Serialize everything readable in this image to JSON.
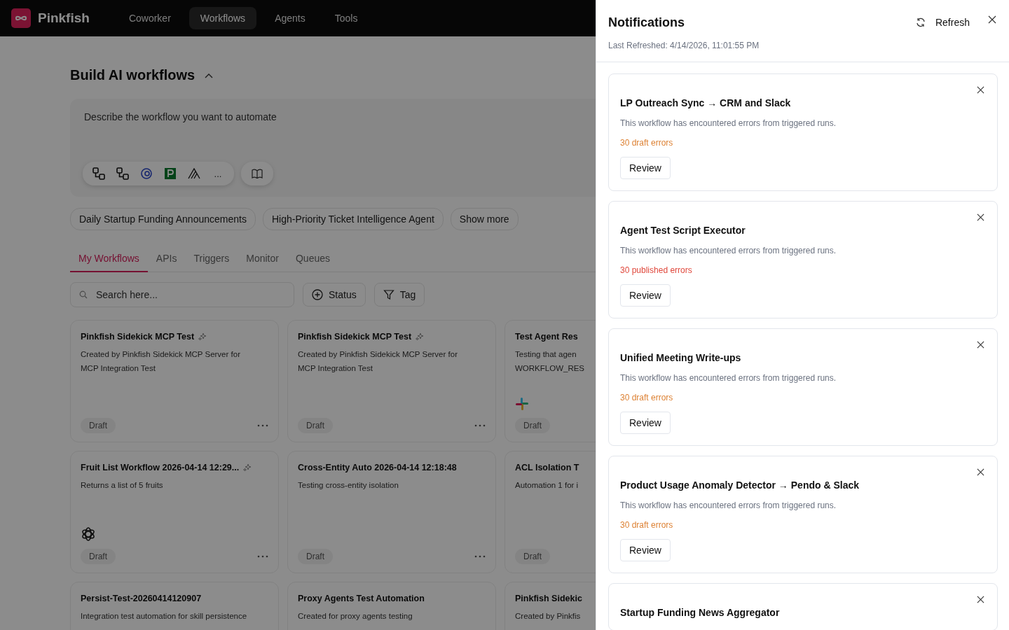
{
  "app": {
    "brand": "Pinkfish"
  },
  "nav": [
    {
      "label": "Coworker",
      "selected": false
    },
    {
      "label": "Workflows",
      "selected": true
    },
    {
      "label": "Agents",
      "selected": false
    },
    {
      "label": "Tools",
      "selected": false
    }
  ],
  "builder": {
    "title": "Build AI workflows",
    "placeholder": "Describe the workflow you want to automate",
    "more": "..."
  },
  "suggestions": [
    "Daily Startup Funding Announcements",
    "High-Priority Ticket Intelligence Agent",
    "Show more"
  ],
  "tabs": [
    {
      "label": "My Workflows",
      "selected": true
    },
    {
      "label": "APIs",
      "selected": false
    },
    {
      "label": "Triggers",
      "selected": false
    },
    {
      "label": "Monitor",
      "selected": false
    },
    {
      "label": "Queues",
      "selected": false
    }
  ],
  "search": {
    "placeholder": "Search here..."
  },
  "filters": [
    {
      "label": "Status",
      "kind": "add"
    },
    {
      "label": "Tag",
      "kind": "filter"
    }
  ],
  "workflows": [
    {
      "title": "Pinkfish Sidekick MCP Test",
      "ai": true,
      "description": [
        "Created by Pinkfish Sidekick MCP Server for",
        "MCP Integration Test"
      ],
      "kind": "plain",
      "status": "Draft"
    },
    {
      "title": "Pinkfish Sidekick MCP Test",
      "ai": true,
      "description": [
        "Created by Pinkfish Sidekick MCP Server for",
        "MCP Integration Test"
      ],
      "kind": "plain",
      "status": "Draft"
    },
    {
      "title": "Test Agent Res",
      "ai": false,
      "description": [
        "Testing that agen",
        "WORKFLOW_RES"
      ],
      "kind": "slack",
      "status": "Draft"
    },
    {
      "title": "Fruit List Workflow 2026-04-14 12:29...",
      "ai": true,
      "description": [
        "Returns a list of 5 fruits"
      ],
      "kind": "openai",
      "status": "Draft"
    },
    {
      "title": "Cross-Entity Auto 2026-04-14 12:18:48",
      "ai": false,
      "description": [
        "Testing cross-entity isolation"
      ],
      "kind": "plain",
      "status": "Draft"
    },
    {
      "title": "ACL Isolation T",
      "ai": false,
      "description": [
        "Automation 1 for i"
      ],
      "kind": "plain",
      "status": "Draft"
    },
    {
      "title": "Persist-Test-20260414120907",
      "ai": false,
      "description": [
        "Integration test automation for skill persistence"
      ],
      "kind": "plain"
    },
    {
      "title": "Proxy Agents Test Automation",
      "ai": false,
      "description": [
        "Created for proxy agents testing"
      ],
      "kind": "plain"
    },
    {
      "title": "Pinkfish Sidekic",
      "ai": false,
      "description": [
        "Created by Pinkfis"
      ],
      "kind": "plain"
    }
  ],
  "notifications": {
    "title": "Notifications",
    "refresh": "Refresh",
    "last_refreshed": "Last Refreshed: 4/14/2026, 11:01:55 PM",
    "items": [
      {
        "title": "LP Outreach Sync → CRM and Slack",
        "message": "This workflow has encountered errors from triggered runs.",
        "errors": "30 draft errors",
        "kind": "draft",
        "action": "Review"
      },
      {
        "title": "Agent Test Script Executor",
        "message": "This workflow has encountered errors from triggered runs.",
        "errors": "30 published errors",
        "kind": "published",
        "action": "Review"
      },
      {
        "title": "Unified Meeting Write-ups",
        "message": "This workflow has encountered errors from triggered runs.",
        "errors": "30 draft errors",
        "kind": "draft",
        "action": "Review"
      },
      {
        "title": "Product Usage Anomaly Detector → Pendo & Slack",
        "message": "This workflow has encountered errors from triggered runs.",
        "errors": "30 draft errors",
        "kind": "draft",
        "action": "Review"
      },
      {
        "title": "Startup Funding News Aggregator"
      }
    ]
  }
}
